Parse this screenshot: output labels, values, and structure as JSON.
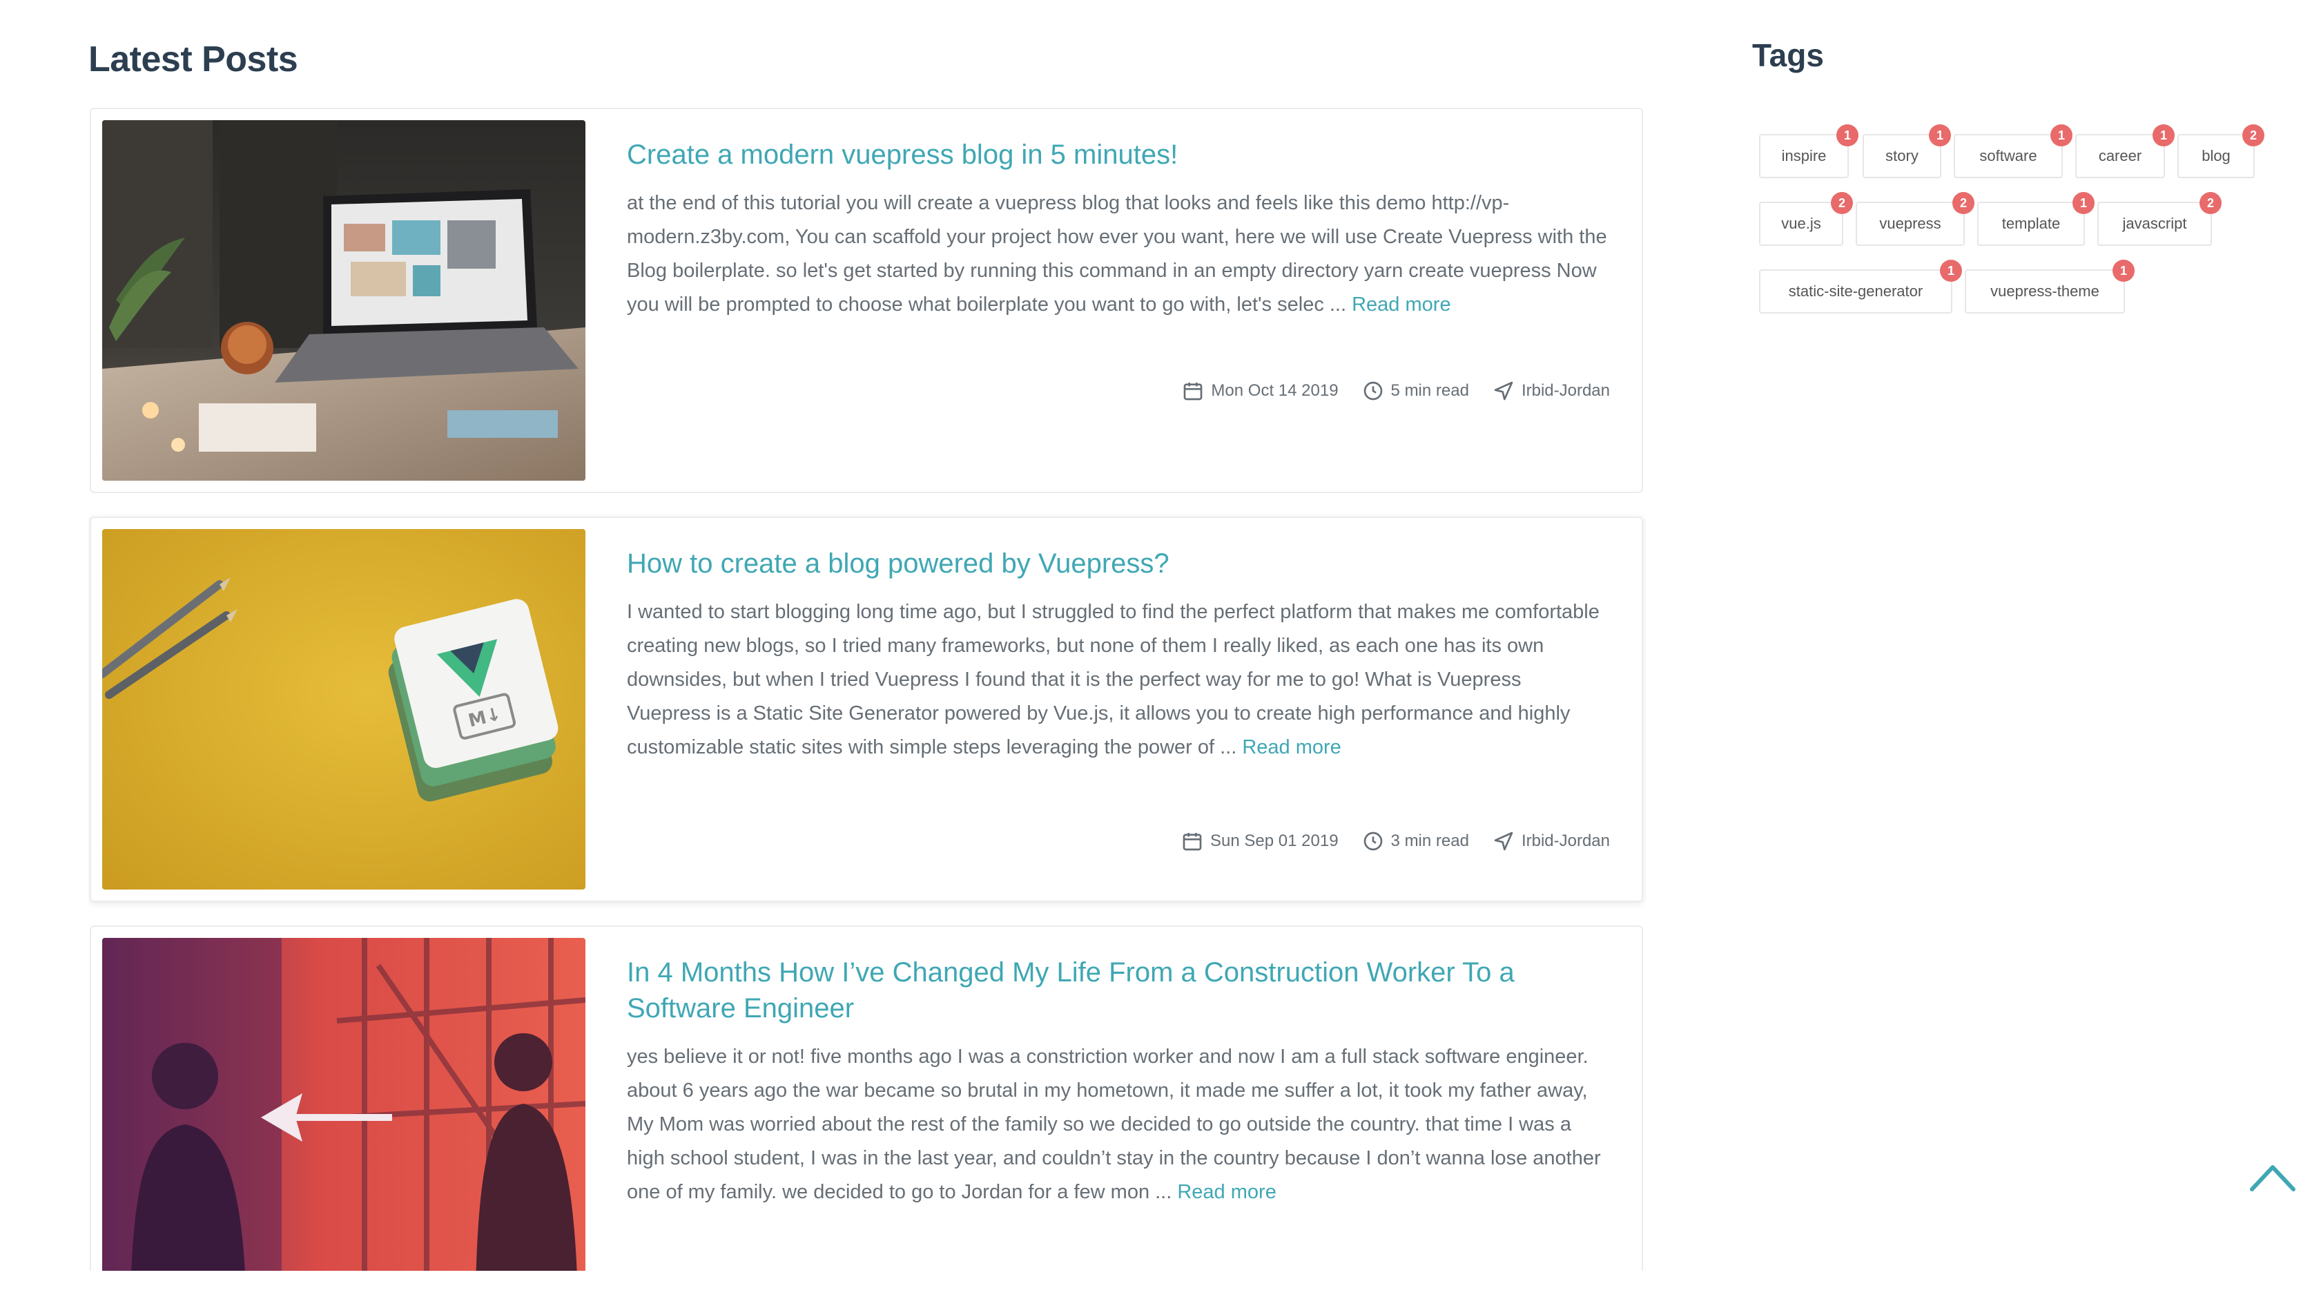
{
  "main": {
    "title": "Latest Posts",
    "posts": [
      {
        "title": "Create a modern vuepress blog in 5 minutes!",
        "excerpt": "at the end of this tutorial you will create a vuepress blog that looks and feels like this demo http://vp-modern.z3by.com, You can scaffold your project how ever you want, here we will use Create Vuepress with the Blog boilerplate. so let's get started by running this command in an empty directory yarn create vuepress Now you will be prompted to choose what boilerplate you want to go with, let's selec ... ",
        "read_more": "Read more",
        "date": "Mon Oct 14 2019",
        "read_time": "5 min read",
        "location": "Irbid-Jordan",
        "image": "laptop-desk-photo"
      },
      {
        "title": "How to create a blog powered by Vuepress?",
        "excerpt": "I wanted to start blogging long time ago, but I struggled to find the perfect platform that makes me comfortable creating new blogs, so I tried many frameworks, but none of them I really liked, as each one has its own downsides, but when I tried Vuepress I found that it is the perfect way for me to go! What is Vuepress Vuepress is a Static Site Generator powered by Vue.js, it allows you to create high performance and highly customizable static sites with simple steps leveraging the power of ... ",
        "read_more": "Read more",
        "date": "Sun Sep 01 2019",
        "read_time": "3 min read",
        "location": "Irbid-Jordan",
        "image": "vue-markdown-pencils-photo"
      },
      {
        "title": "In 4 Months How I’ve Changed My Life From a Construction Worker To a Software Engineer",
        "excerpt": "yes believe it or not! five months ago I was a constriction worker and now I am a full stack software engineer. about 6 years ago the war became so brutal in my hometown, it made me suffer a lot, it took my father away, My Mom was worried about the rest of the family so we decided to go outside the country. that time I was a high school student, I was in the last year, and couldn’t stay in the country because I don’t wanna lose another one of my family. we decided to go to Jordan for a few mon ... ",
        "read_more": "Read more",
        "image": "construction-worker-photo"
      }
    ]
  },
  "tags": {
    "title": "Tags",
    "items": [
      {
        "label": "inspire",
        "count": "1"
      },
      {
        "label": "story",
        "count": "1"
      },
      {
        "label": "software",
        "count": "1"
      },
      {
        "label": "career",
        "count": "1"
      },
      {
        "label": "blog",
        "count": "2"
      },
      {
        "label": "vue.js",
        "count": "2"
      },
      {
        "label": "vuepress",
        "count": "2"
      },
      {
        "label": "template",
        "count": "1"
      },
      {
        "label": "javascript",
        "count": "2"
      },
      {
        "label": "static-site-generator",
        "count": "1"
      },
      {
        "label": "vuepress-theme",
        "count": "1"
      }
    ]
  },
  "icons": {
    "calendar": "calendar-icon",
    "clock": "clock-icon",
    "location": "navigation-arrow-icon",
    "back_to_top": "chevron-up-icon"
  },
  "colors": {
    "accent": "#3fa7b4",
    "badge": "#e86a6a",
    "text_muted": "#666e75",
    "heading": "#2c3e50"
  }
}
